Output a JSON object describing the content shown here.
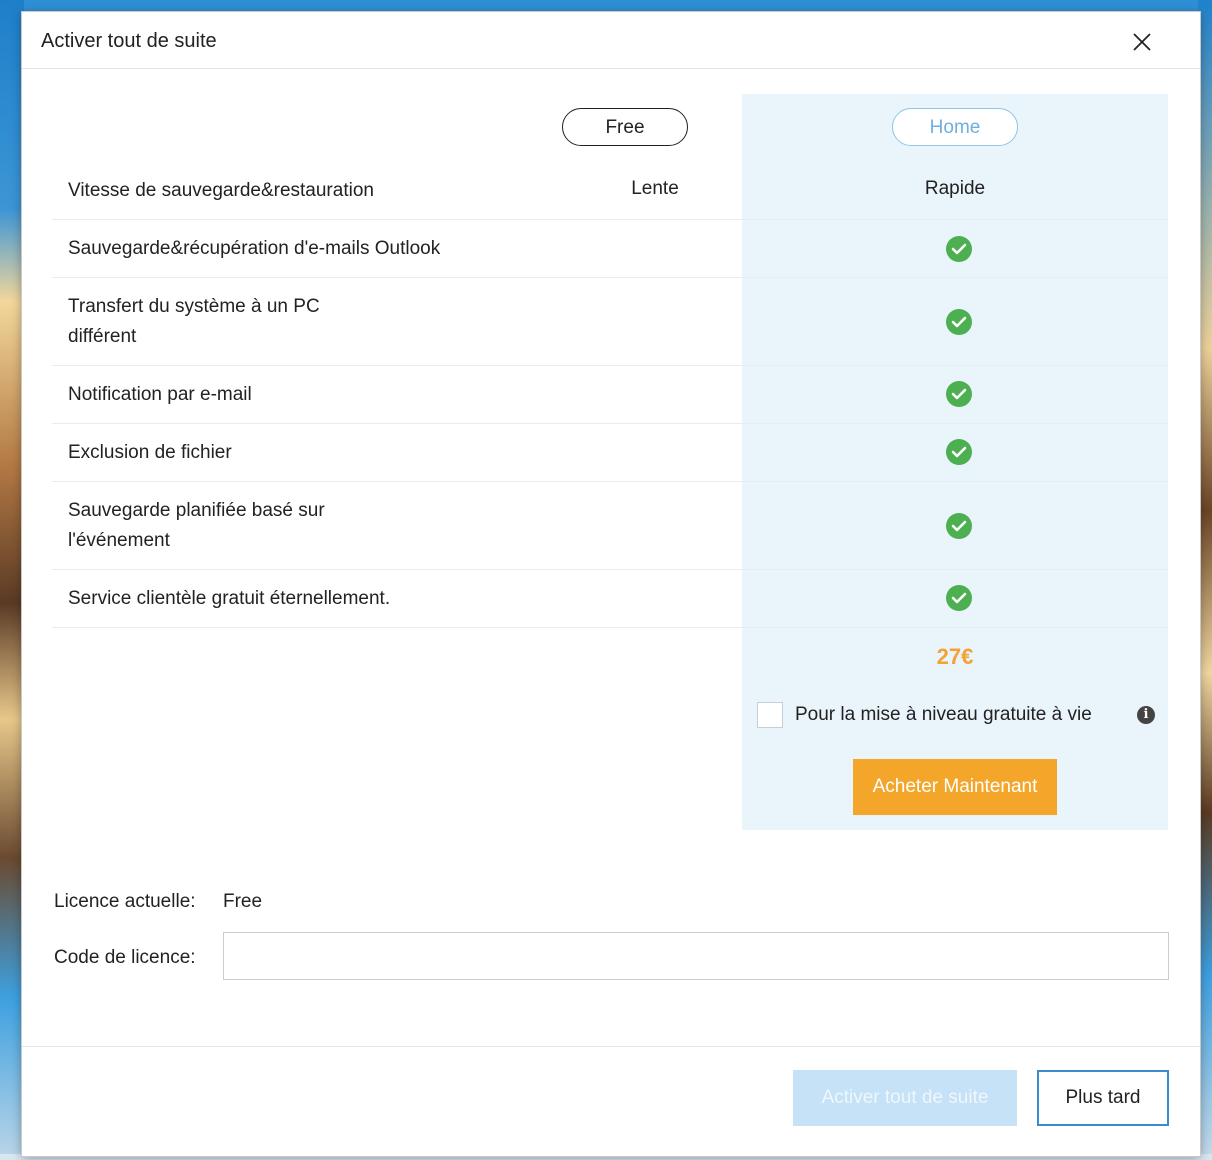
{
  "dialog": {
    "title": "Activer tout de suite"
  },
  "plans": {
    "free_label": "Free",
    "home_label": "Home"
  },
  "features": [
    {
      "label": "Vitesse de sauvegarde&restauration",
      "free": "Lente",
      "home": "Rapide"
    },
    {
      "label": "Sauvegarde&récupération d'e-mails Outlook",
      "free": "",
      "home": "check"
    },
    {
      "label": "Transfert du système à un PC\ndifférent",
      "free": "",
      "home": "check"
    },
    {
      "label": "Notification par e-mail",
      "free": "",
      "home": "check"
    },
    {
      "label": "Exclusion de fichier",
      "free": "",
      "home": "check"
    },
    {
      "label": "Sauvegarde planifiée basé sur\nl'événement",
      "free": "",
      "home": "check"
    },
    {
      "label": "Service clientèle gratuit éternellement.",
      "free": "",
      "home": "check"
    }
  ],
  "pricing": {
    "price": "27€",
    "upgrade_label": "Pour la mise à niveau gratuite à vie",
    "upgrade_checked": false,
    "buy_label": "Acheter Maintenant"
  },
  "license": {
    "current_label": "Licence actuelle:",
    "current_value": "Free",
    "code_label": "Code de licence:",
    "code_value": "",
    "code_placeholder": ""
  },
  "footer": {
    "activate_label": "Activer tout de suite",
    "later_label": "Plus tard"
  },
  "icons": {
    "close": "close-icon",
    "check": "check-circle-icon",
    "info": "info-icon"
  },
  "colors": {
    "accent_orange": "#f4a62a",
    "price_orange": "#f4a233",
    "check_green": "#4caf50",
    "home_column_bg": "#eaf4fb",
    "home_pill_border": "#8ec6ea",
    "activate_disabled": "#c5e2f6",
    "later_border": "#3a8bd0"
  }
}
